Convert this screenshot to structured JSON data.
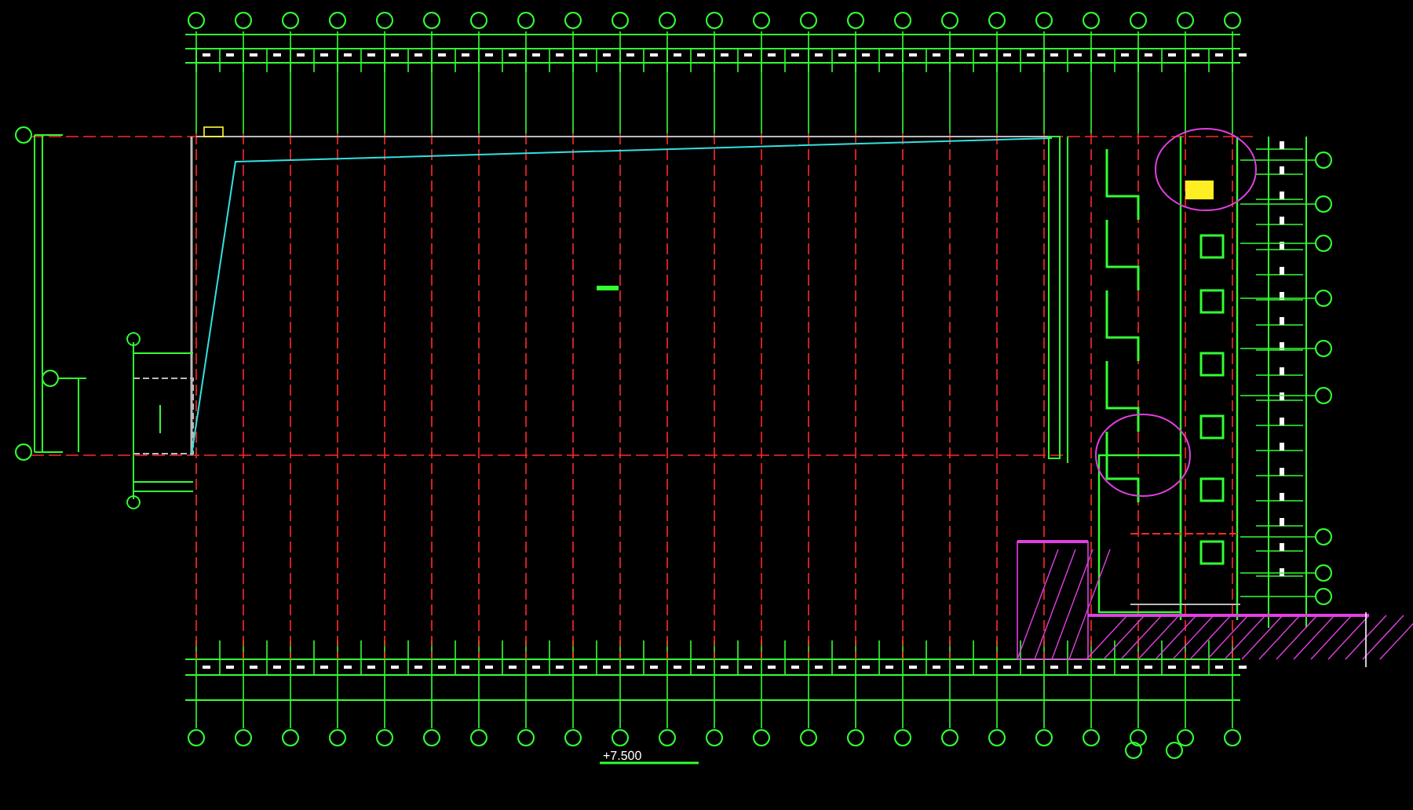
{
  "drawing": {
    "level_label": "+7.500"
  }
}
